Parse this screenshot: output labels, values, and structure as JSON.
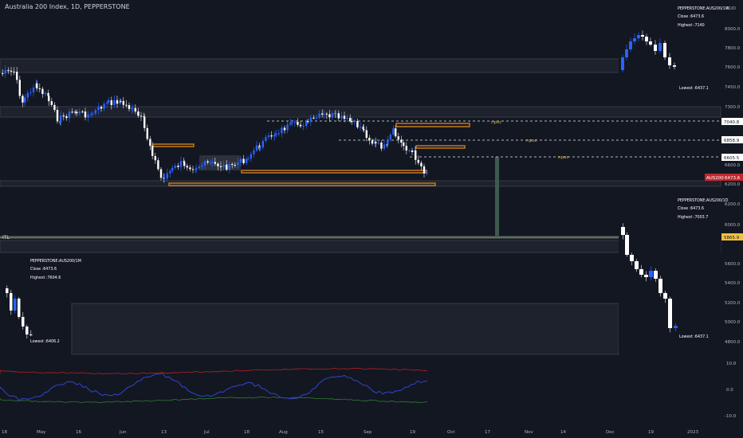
{
  "header": {
    "title": "Australia 200 Index, 1D, PEPPERSTONE"
  },
  "currency_label": "AUD",
  "colors": {
    "background": "#131722",
    "band": "#1e222d",
    "band_border": "#2a2e39",
    "bull": "#2962ff",
    "bear": "#ffffff",
    "orange": "#c47a1e",
    "dotted": "#b2b5be",
    "label_bg": "#ffffff",
    "symbol_tag": "#c1272d",
    "rsi_line": "#3344cc",
    "rsi_upper": "#b22222",
    "rsi_lower": "#2e7d32"
  },
  "main_axis": {
    "ticks": [
      "8000.0",
      "7800.0",
      "7600.0",
      "7450.0",
      "7300.0",
      "7040.8",
      "6858.9",
      "6605.5",
      "6600.0",
      "6400.0",
      "6200.0",
      "6000.0",
      "5800.0",
      "5600.0",
      "5400.0",
      "5200.0",
      "5000.0",
      "4800.0"
    ],
    "price_labels": [
      {
        "text": "7040.8",
        "style": "white"
      },
      {
        "text": "6858.9",
        "style": "white"
      },
      {
        "text": "6605.5",
        "style": "white"
      },
      {
        "text": "6473.6",
        "style": "tag",
        "symbol": "AUS200"
      },
      {
        "text": "5865.9",
        "style": "yellow"
      }
    ]
  },
  "rsi_axis": {
    "ticks": [
      "10.0",
      "0.0",
      "-10.0"
    ]
  },
  "time_axis": {
    "labels": [
      "18",
      "May",
      "16",
      "Jun",
      "13",
      "Jul",
      "18",
      "Aug",
      "15",
      "Sep",
      "19",
      "Oct",
      "17",
      "Nov",
      "14",
      "Dec",
      "19",
      "2023"
    ]
  },
  "npoc_labels": [
    "npoc",
    "npoc",
    "npoc"
  ],
  "itl_label": "ITL",
  "inset_weekly": {
    "symbol": "PEPPERSTONE:AUS200/1W",
    "close": "Close :6473.6",
    "highest": "Highest :7140",
    "lowest": "Lowest :6437.1"
  },
  "inset_daily": {
    "symbol": "PEPPERSTONE:AUS200/1D",
    "close": "Close :6473.6",
    "highest": "Highest :7003.7",
    "lowest": "Lowest :6437.1"
  },
  "inset_monthly": {
    "symbol": "PEPPERSTONE:AUS200/1M",
    "close": "Close :6473.6",
    "highest": "Highest :7604.6",
    "lowest": "Lowest :6406.2"
  }
}
